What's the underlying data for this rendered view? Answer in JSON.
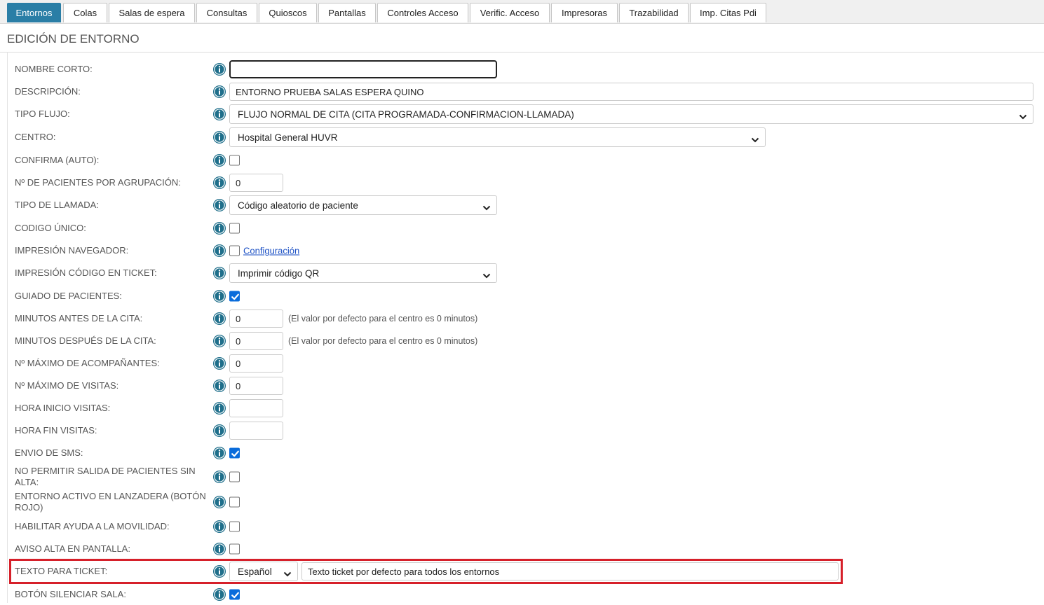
{
  "tabs": [
    {
      "label": "Entornos",
      "active": true
    },
    {
      "label": "Colas"
    },
    {
      "label": "Salas de espera"
    },
    {
      "label": "Consultas"
    },
    {
      "label": "Quioscos"
    },
    {
      "label": "Pantallas"
    },
    {
      "label": "Controles Acceso"
    },
    {
      "label": "Verific. Acceso"
    },
    {
      "label": "Impresoras"
    },
    {
      "label": "Trazabilidad"
    },
    {
      "label": "Imp. Citas Pdi"
    }
  ],
  "page": {
    "title": "EDICIÓN DE ENTORNO"
  },
  "colors": {
    "accent": "#2a7ea6",
    "checkbox_checked": "#0a6cdb",
    "highlight": "#d6202a",
    "info_icon": "#1f6f8b"
  },
  "form": {
    "nombre_corto": {
      "label": "NOMBRE CORTO:",
      "value": ""
    },
    "descripcion": {
      "label": "DESCRIPCIÓN:",
      "value": "ENTORNO PRUEBA SALAS ESPERA QUINO"
    },
    "tipo_flujo": {
      "label": "TIPO FLUJO:",
      "value": "FLUJO NORMAL DE CITA (CITA PROGRAMADA-CONFIRMACION-LLAMADA)"
    },
    "centro": {
      "label": "CENTRO:",
      "value": "Hospital General HUVR"
    },
    "confirma_auto": {
      "label": "CONFIRMA (AUTO):",
      "checked": false
    },
    "pacientes_por_agrupacion": {
      "label": "Nº DE PACIENTES POR AGRUPACIÓN:",
      "value": "0"
    },
    "tipo_llamada": {
      "label": "TIPO DE LLAMADA:",
      "value": "Código aleatorio de paciente"
    },
    "codigo_unico": {
      "label": "CODIGO ÚNICO:",
      "checked": false
    },
    "impresion_navegador": {
      "label": "IMPRESIÓN NAVEGADOR:",
      "checked": false,
      "link": "Configuración"
    },
    "impresion_codigo_ticket": {
      "label": "IMPRESIÓN CÓDIGO EN TICKET:",
      "value": "Imprimir código QR"
    },
    "guiado_pacientes": {
      "label": "GUIADO DE PACIENTES:",
      "checked": true
    },
    "minutos_antes": {
      "label": "MINUTOS ANTES DE LA CITA:",
      "value": "0",
      "hint": "(El valor por defecto para el centro es 0 minutos)"
    },
    "minutos_despues": {
      "label": "MINUTOS DESPUÉS DE LA CITA:",
      "value": "0",
      "hint": "(El valor por defecto para el centro es 0 minutos)"
    },
    "max_acompanantes": {
      "label": "Nº MÁXIMO DE ACOMPAÑANTES:",
      "value": "0"
    },
    "max_visitas": {
      "label": "Nº MÁXIMO DE VISITAS:",
      "value": "0"
    },
    "hora_inicio_visitas": {
      "label": "HORA INICIO VISITAS:",
      "value": ""
    },
    "hora_fin_visitas": {
      "label": "HORA FIN VISITAS:",
      "value": ""
    },
    "envio_sms": {
      "label": "ENVIO DE SMS:",
      "checked": true
    },
    "no_permitir_salida": {
      "label": "NO PERMITIR SALIDA DE PACIENTES SIN ALTA:",
      "checked": false
    },
    "entorno_lanzadera": {
      "label": "ENTORNO ACTIVO EN LANZADERA (BOTÓN ROJO)",
      "checked": false
    },
    "ayuda_movilidad": {
      "label": "HABILITAR AYUDA A LA MOVILIDAD:",
      "checked": false
    },
    "aviso_alta_pantalla": {
      "label": "AVISO ALTA EN PANTALLA:",
      "checked": false
    },
    "texto_ticket": {
      "label": "TEXTO PARA TICKET:",
      "language": "Español",
      "value": "Texto ticket por defecto para todos los entornos"
    },
    "boton_silenciar_sala": {
      "label": "BOTÓN SILENCIAR SALA:",
      "checked": true
    }
  }
}
